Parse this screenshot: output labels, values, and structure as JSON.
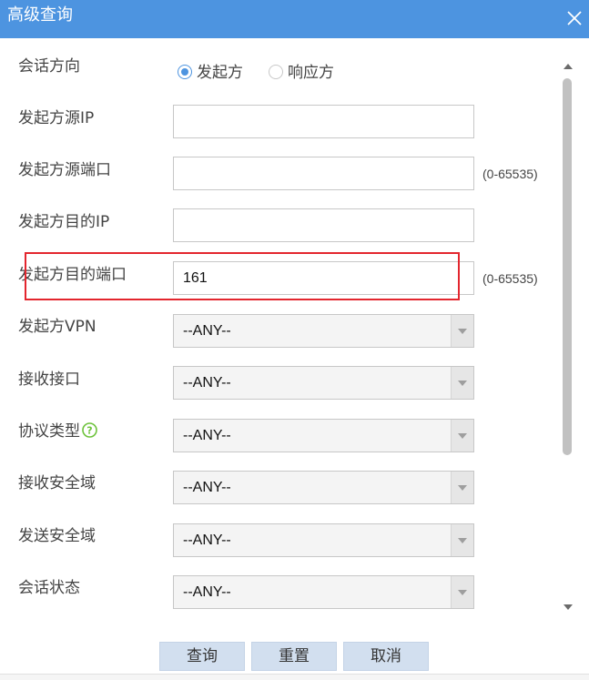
{
  "dialog": {
    "title": "高级查询"
  },
  "form": {
    "direction": {
      "label": "会话方向",
      "options": [
        {
          "label": "发起方",
          "checked": true
        },
        {
          "label": "响应方",
          "checked": false
        }
      ]
    },
    "initiator_src_ip": {
      "label": "发起方源IP",
      "value": ""
    },
    "initiator_src_port": {
      "label": "发起方源端口",
      "value": "",
      "hint": "(0-65535)"
    },
    "initiator_dst_ip": {
      "label": "发起方目的IP",
      "value": ""
    },
    "initiator_dst_port": {
      "label": "发起方目的端口",
      "value": "161",
      "hint": "(0-65535)"
    },
    "initiator_vpn": {
      "label": "发起方VPN",
      "value": "--ANY--"
    },
    "recv_interface": {
      "label": "接收接口",
      "value": "--ANY--"
    },
    "protocol_type": {
      "label": "协议类型",
      "value": "--ANY--",
      "help_icon": "question-circle-icon"
    },
    "recv_zone": {
      "label": "接收安全域",
      "value": "--ANY--"
    },
    "send_zone": {
      "label": "发送安全域",
      "value": "--ANY--"
    },
    "session_state": {
      "label": "会话状态",
      "value": "--ANY--"
    }
  },
  "footer": {
    "query_label": "查询",
    "reset_label": "重置",
    "cancel_label": "取消"
  },
  "colors": {
    "title_bar": "#4d94e0",
    "highlight": "#e3262e",
    "button_bg": "#d2dfef"
  }
}
